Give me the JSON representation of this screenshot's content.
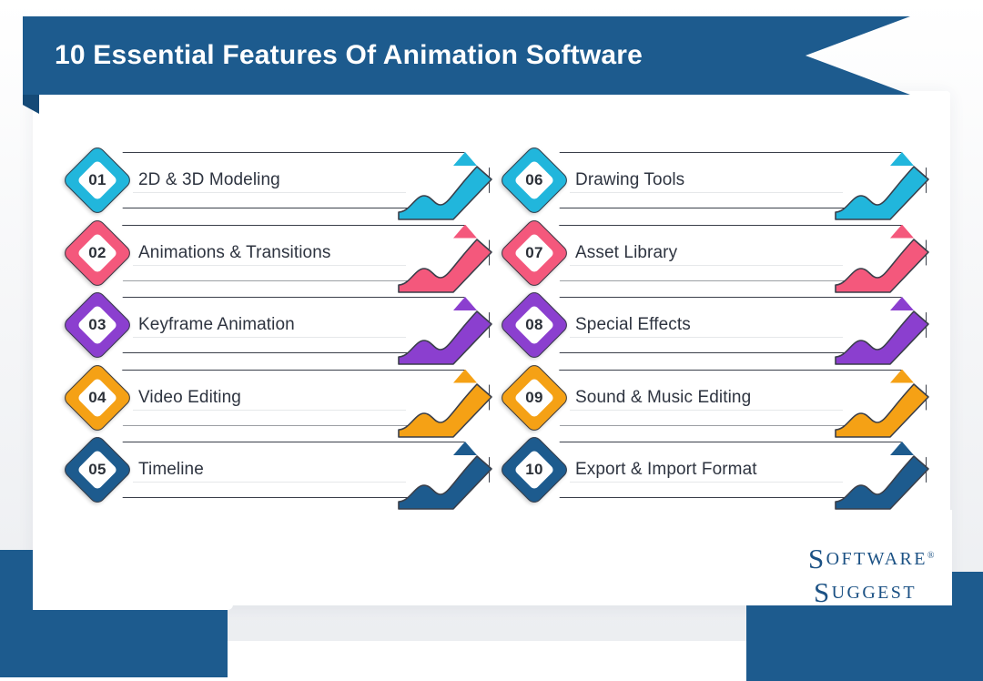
{
  "header": {
    "title": "10 Essential Features Of Animation Software"
  },
  "brand": {
    "logo_line1_cap": "S",
    "logo_line1_rest": "OFTWARE",
    "logo_registered": "®",
    "logo_line2_cap": "S",
    "logo_line2_rest": "UGGEST",
    "logo_name": "SoftwareSuggest"
  },
  "colors": {
    "navy": "#1d5b8e",
    "cyan": "#21b6dc",
    "pink": "#f4587c",
    "purple": "#8b3fcf",
    "orange": "#f5a115",
    "outline": "#3a3f4a",
    "text": "#2e3440",
    "card": "#ffffff"
  },
  "features": [
    {
      "number": "01",
      "label": "2D & 3D Modeling",
      "color": "#21b6dc",
      "column": "left",
      "row": 0
    },
    {
      "number": "02",
      "label": "Animations & Transitions",
      "color": "#f4587c",
      "column": "left",
      "row": 1
    },
    {
      "number": "03",
      "label": "Keyframe Animation",
      "color": "#8b3fcf",
      "column": "left",
      "row": 2
    },
    {
      "number": "04",
      "label": "Video Editing",
      "color": "#f5a115",
      "column": "left",
      "row": 3
    },
    {
      "number": "05",
      "label": "Timeline",
      "color": "#1d5b8e",
      "column": "left",
      "row": 4
    },
    {
      "number": "06",
      "label": "Drawing Tools",
      "color": "#21b6dc",
      "column": "right",
      "row": 0
    },
    {
      "number": "07",
      "label": "Asset Library",
      "color": "#f4587c",
      "column": "right",
      "row": 1
    },
    {
      "number": "08",
      "label": "Special Effects",
      "color": "#8b3fcf",
      "column": "right",
      "row": 2
    },
    {
      "number": "09",
      "label": "Sound & Music Editing",
      "color": "#f5a115",
      "column": "right",
      "row": 3
    },
    {
      "number": "10",
      "label": "Export & Import Format",
      "color": "#1d5b8e",
      "column": "right",
      "row": 4
    }
  ]
}
